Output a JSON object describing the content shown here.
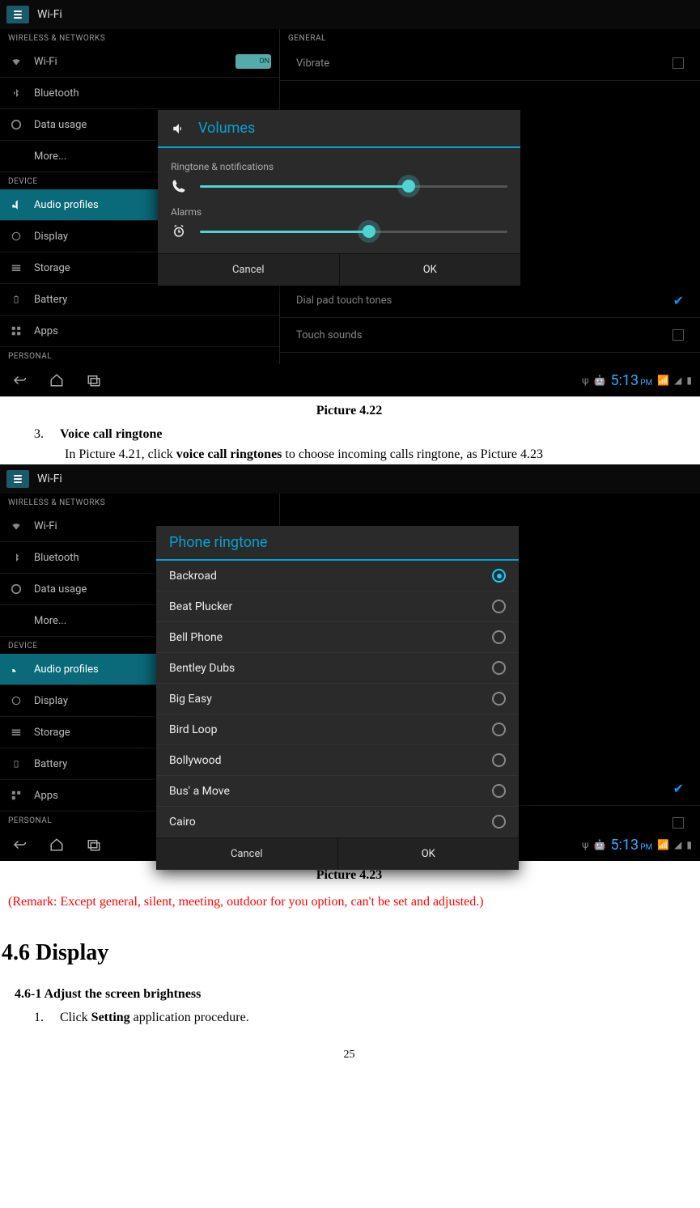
{
  "shot_top_title": "Wi-Fi",
  "sections": {
    "wireless_networks": "WIRELESS & NETWORKS",
    "device": "DEVICE",
    "personal": "PERSONAL",
    "general": "GENERAL"
  },
  "left_items": {
    "wifi": "Wi-Fi",
    "bluetooth": "Bluetooth",
    "data_usage": "Data usage",
    "more": "More...",
    "audio_profiles": "Audio profiles",
    "display": "Display",
    "storage": "Storage",
    "battery": "Battery",
    "apps": "Apps"
  },
  "toggle_on_text": "ON",
  "right_items": {
    "vibrate": "Vibrate",
    "dial_pad_touch_tones": "Dial pad touch tones",
    "touch_sounds": "Touch sounds"
  },
  "volumes_dialog": {
    "title": "Volumes",
    "ringtone_label": "Ringtone & notifications",
    "alarms_label": "Alarms",
    "cancel": "Cancel",
    "ok": "OK"
  },
  "ringtone_dialog": {
    "title": "Phone ringtone",
    "options": [
      "Backroad",
      "Beat Plucker",
      "Bell Phone",
      "Bentley Dubs",
      "Big Easy",
      "Bird Loop",
      "Bollywood",
      "Bus' a Move",
      "Cairo"
    ],
    "cancel": "Cancel",
    "ok": "OK"
  },
  "status_bar": {
    "time": "5:13",
    "pm": "PM"
  },
  "doc": {
    "caption1": "Picture 4.22",
    "item3_num": "3.",
    "item3_title": "Voice call ringtone",
    "item3_body_1": "In Picture 4.21, click ",
    "item3_body_bold": "voice call ringtones",
    "item3_body_2": " to choose incoming calls ringtone, as Picture 4.23",
    "caption2": "Picture 4.23",
    "remark": "(Remark: Except general, silent, meeting, outdoor for you option, can't be set and adjusted.)",
    "section46": "4.6  Display",
    "sub461": "4.6-1 Adjust the screen brightness",
    "step1_num": "1.",
    "step1_a": "Click ",
    "step1_bold": "Setting",
    "step1_b": " application procedure.",
    "page_num": "25"
  }
}
